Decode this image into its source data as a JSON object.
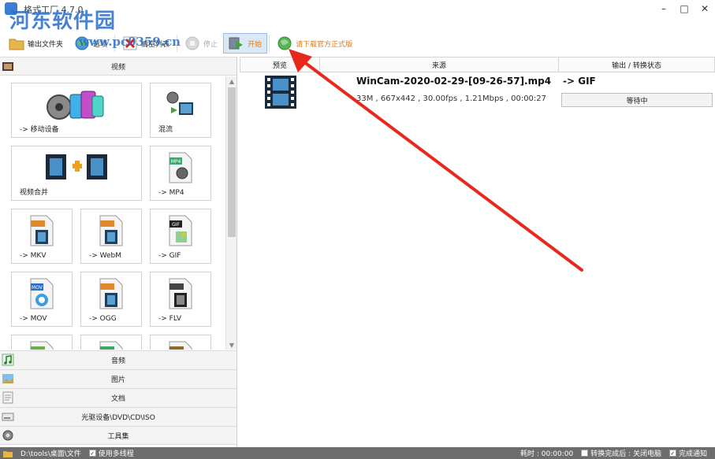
{
  "window": {
    "title": "格式工厂 4.7.0",
    "minimize": "–",
    "maximize": "□",
    "close": "✕"
  },
  "watermark": {
    "text": "河东软件园",
    "url": "www.pc0359.cn"
  },
  "toolbar": {
    "output_folder": "输出文件夹",
    "options": "选项",
    "clear_list": "清空列表",
    "stop": "停止",
    "start": "开始",
    "download": "请下载官方正式版"
  },
  "sidebar": {
    "video_header": "视频",
    "tiles": [
      {
        "label": "-> 移动设备",
        "icon": "mobile-device-icon"
      },
      {
        "label": "混流",
        "icon": "mux-icon"
      },
      {
        "label": "视频合并",
        "icon": "video-merge-icon"
      },
      {
        "label": "-> MP4",
        "icon": "mp4-icon"
      },
      {
        "label": "-> MKV",
        "icon": "mkv-icon"
      },
      {
        "label": "-> WebM",
        "icon": "webm-icon"
      },
      {
        "label": "-> GIF",
        "icon": "gif-icon"
      },
      {
        "label": "-> MOV",
        "icon": "mov-icon"
      },
      {
        "label": "-> OGG",
        "icon": "ogg-icon"
      },
      {
        "label": "-> FLV",
        "icon": "flv-icon"
      }
    ],
    "tile_badges": {
      "mp4": "MP4",
      "gif": "GIF",
      "mov": "MOV"
    },
    "categories": [
      {
        "label": "音频",
        "icon": "audio-icon"
      },
      {
        "label": "图片",
        "icon": "picture-icon"
      },
      {
        "label": "文档",
        "icon": "document-icon"
      },
      {
        "label": "光驱设备\\DVD\\CD\\ISO",
        "icon": "disc-icon"
      },
      {
        "label": "工具集",
        "icon": "toolbox-icon"
      }
    ]
  },
  "list": {
    "headers": {
      "preview": "预览",
      "source": "来源",
      "output_status": "输出 / 转换状态"
    },
    "rows": [
      {
        "filename": "WinCam-2020-02-29-[09-26-57].mp4",
        "info": "33M , 667x442 , 30.00fps , 1.21Mbps , 00:00:27",
        "target": "-> GIF",
        "status": "等待中"
      }
    ]
  },
  "statusbar": {
    "path": "D:\\tools\\桌面\\文件",
    "multithread": "使用多线程",
    "elapsed_label": "耗时 : 00:00:00",
    "after_done": "转换完成后 : 关闭电脑",
    "notify": "完成通知"
  },
  "colors": {
    "accent": "#2a6ec7",
    "arrow": "#e8281e",
    "statusbar_bg": "#6d6d6d",
    "download_text": "#e07a10"
  }
}
